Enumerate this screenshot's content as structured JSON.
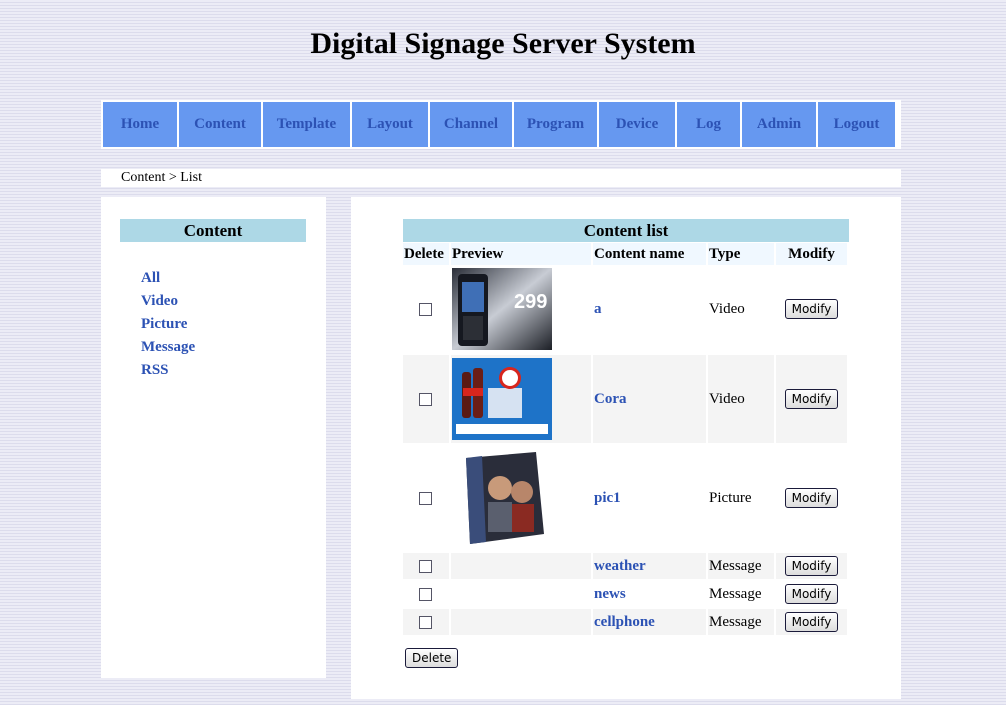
{
  "page": {
    "title": "Digital Signage Server System"
  },
  "nav": {
    "items": [
      "Home",
      "Content",
      "Template",
      "Layout",
      "Channel",
      "Program",
      "Device",
      "Log",
      "Admin",
      "Logout"
    ]
  },
  "breadcrumb": {
    "text": "Content > List"
  },
  "sidebar": {
    "heading": "Content",
    "links": [
      "All",
      "Video",
      "Picture",
      "Message",
      "RSS"
    ]
  },
  "content_list": {
    "title": "Content list",
    "columns": {
      "delete": "Delete",
      "preview": "Preview",
      "name": "Content name",
      "type": "Type",
      "modify": "Modify"
    },
    "rows": [
      {
        "name": "a",
        "type": "Video",
        "button": "Modify",
        "preview": "phone-ad-thumbnail"
      },
      {
        "name": "Cora",
        "type": "Video",
        "button": "Modify",
        "preview": "cola-ad-thumbnail"
      },
      {
        "name": "pic1",
        "type": "Picture",
        "button": "Modify",
        "preview": "people-poster-thumbnail"
      },
      {
        "name": "weather",
        "type": "Message",
        "button": "Modify"
      },
      {
        "name": "news",
        "type": "Message",
        "button": "Modify"
      },
      {
        "name": "cellphone",
        "type": "Message",
        "button": "Modify"
      }
    ],
    "delete_button": "Delete"
  },
  "colors": {
    "nav_bg": "#6698f0",
    "nav_text": "#2c52b4",
    "heading_bg": "#add8e6",
    "link": "#2c52b4"
  }
}
